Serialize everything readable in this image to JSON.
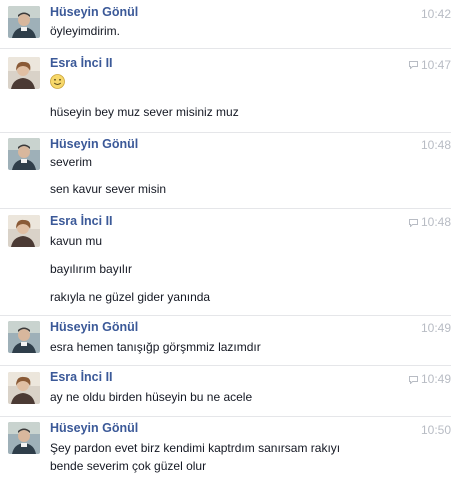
{
  "colors": {
    "name": "#3b5998",
    "time": "#b8bcc4",
    "text": "#141823",
    "divider": "#e5e6e9"
  },
  "conversation": [
    {
      "sender": "Hüseyin Gönül",
      "avatar": "huseyin-avatar",
      "time": "10:42",
      "messages": [
        "öyleyimdirim."
      ]
    },
    {
      "sender": "Esra İnci II",
      "avatar": "esra-avatar",
      "time": "10:47",
      "seen_icon": "message-seen-icon",
      "emoji": "slightly-smiling-face-icon",
      "messages": [
        "hüseyin bey muz sever misiniz muz"
      ]
    },
    {
      "sender": "Hüseyin Gönül",
      "avatar": "huseyin-avatar",
      "time": "10:48",
      "messages": [
        "severim",
        "sen kavur sever misin"
      ]
    },
    {
      "sender": "Esra İnci II",
      "avatar": "esra-avatar",
      "time": "10:48",
      "seen_icon": "message-seen-icon",
      "messages": [
        "kavun mu",
        "bayılırım bayılır",
        "rakıyla ne güzel gider yanında"
      ]
    },
    {
      "sender": "Hüseyin Gönül",
      "avatar": "huseyin-avatar",
      "time": "10:49",
      "messages": [
        "esra hemen tanışığp görşmmiz lazımdır"
      ]
    },
    {
      "sender": "Esra İnci II",
      "avatar": "esra-avatar",
      "time": "10:49",
      "seen_icon": "message-seen-icon",
      "messages": [
        "ay ne oldu birden hüseyin bu ne acele"
      ]
    },
    {
      "sender": "Hüseyin Gönül",
      "avatar": "huseyin-avatar",
      "time": "10:50",
      "messages": [
        "Şey pardon evet birz kendimi kaptrdım sanırsam rakıyı",
        "bende severim çok güzel olur"
      ]
    }
  ]
}
